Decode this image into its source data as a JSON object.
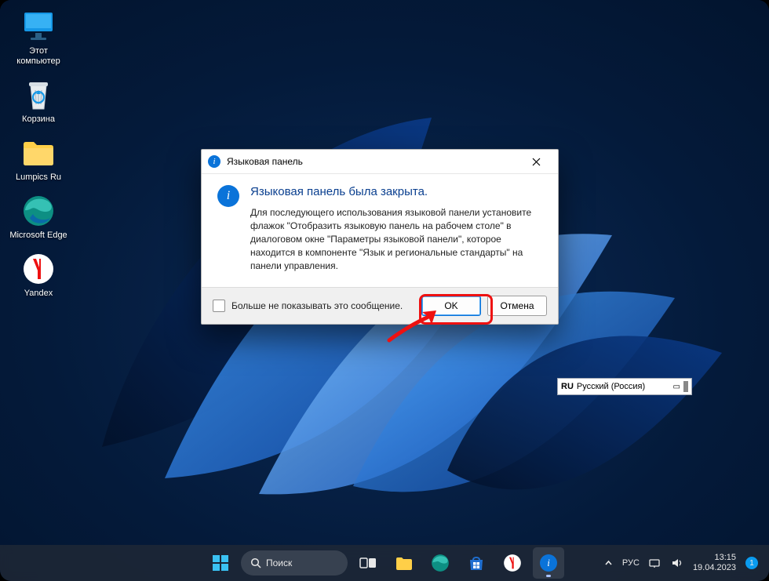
{
  "desktop": {
    "icons": [
      {
        "name": "this-pc",
        "label": "Этот\nкомпьютер"
      },
      {
        "name": "recycle-bin",
        "label": "Корзина"
      },
      {
        "name": "folder-lumpics",
        "label": "Lumpics Ru"
      },
      {
        "name": "edge",
        "label": "Microsoft\nEdge"
      },
      {
        "name": "yandex",
        "label": "Yandex"
      }
    ]
  },
  "dialog": {
    "title": "Языковая панель",
    "heading": "Языковая панель была закрыта.",
    "body": "Для последующего использования языковой панели установите флажок \"Отобразить языковую панель на рабочем столе\" в диалоговом окне \"Параметры языковой панели\", которое находится в компоненте \"Язык и региональные стандарты\" на панели управления.",
    "checkbox_label": "Больше не показывать это сообщение.",
    "ok": "OK",
    "cancel": "Отмена"
  },
  "langbar": {
    "code": "RU",
    "name": "Русский (Россия)"
  },
  "taskbar": {
    "search": "Поиск",
    "time": "13:15",
    "date": "19.04.2023",
    "lang": "РУС",
    "notif": "1"
  }
}
